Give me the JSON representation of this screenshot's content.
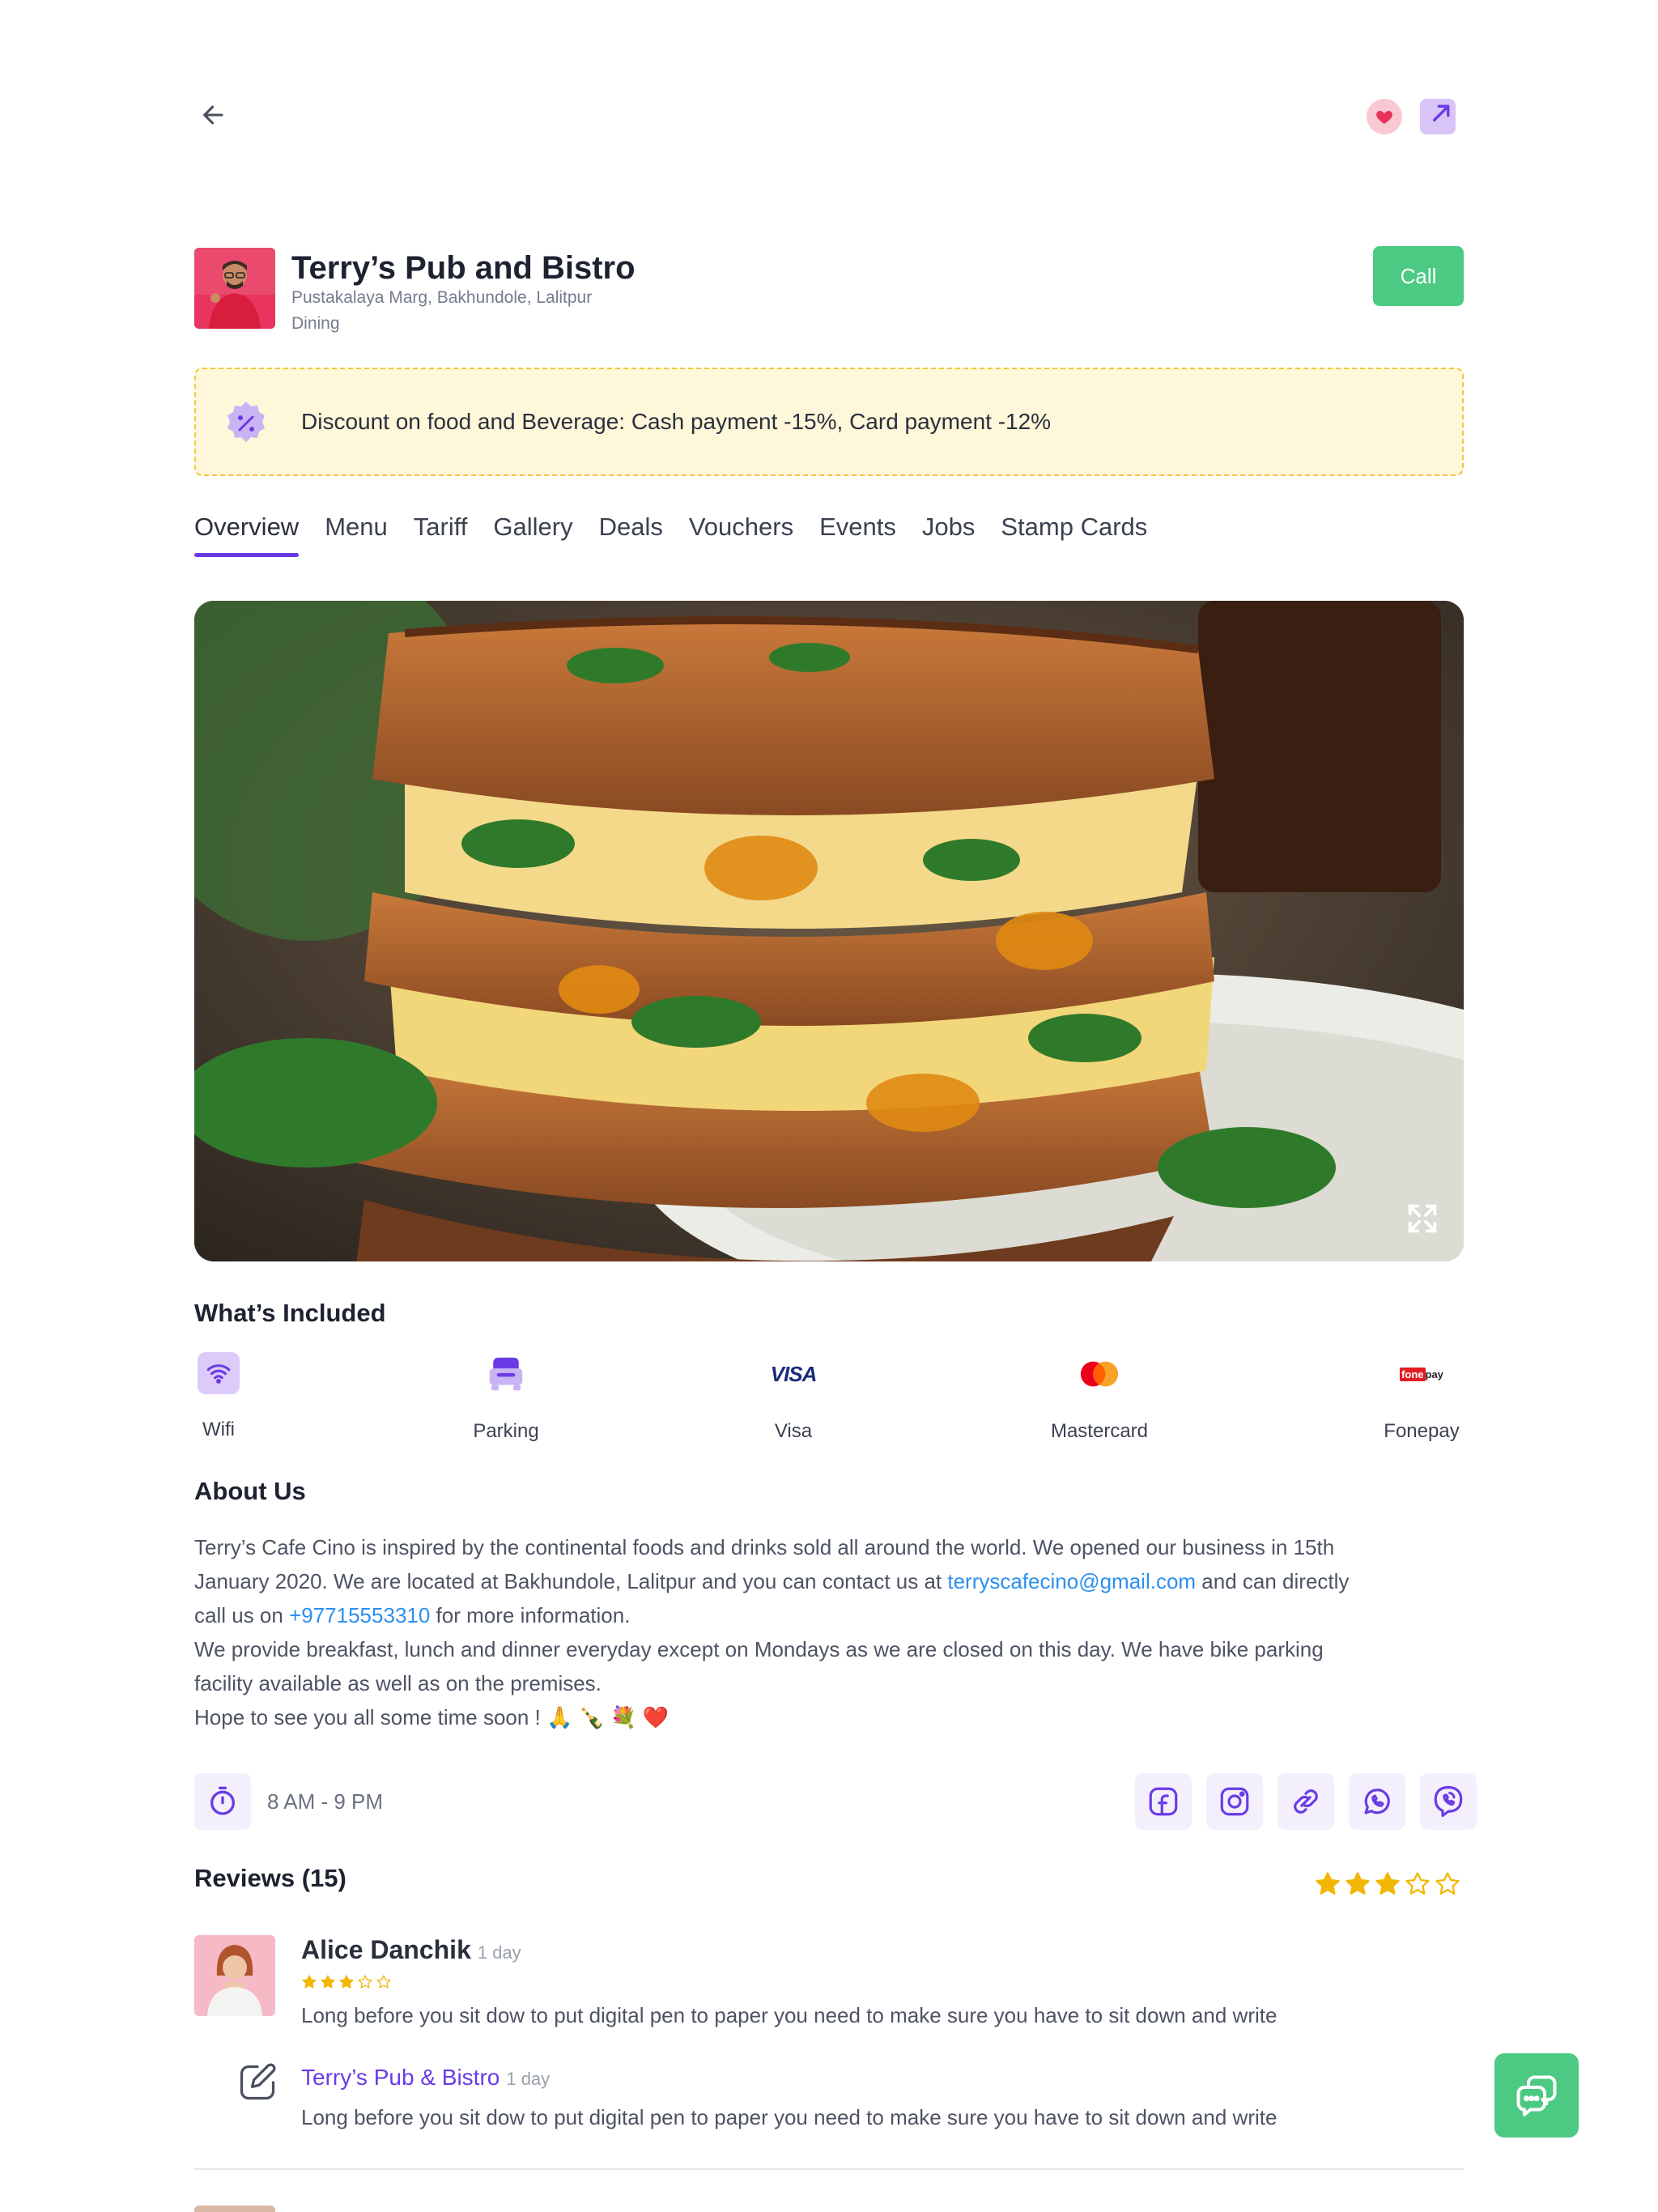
{
  "business": {
    "name": "Terry’s Pub and Bistro",
    "address": "Pustakalaya Marg, Bakhundole, Lalitpur",
    "category": "Dining",
    "call_label": "Call"
  },
  "discount": {
    "text": "Discount on food and Beverage: Cash payment -15%, Card payment -12%"
  },
  "tabs": [
    {
      "label": "Overview",
      "active": true
    },
    {
      "label": "Menu"
    },
    {
      "label": "Tariff"
    },
    {
      "label": "Gallery"
    },
    {
      "label": "Deals"
    },
    {
      "label": "Vouchers"
    },
    {
      "label": "Events"
    },
    {
      "label": "Jobs"
    },
    {
      "label": "Stamp Cards"
    }
  ],
  "included": {
    "title": "What’s Included",
    "items": [
      {
        "label": "Wifi",
        "icon": "wifi-icon"
      },
      {
        "label": "Parking",
        "icon": "car-icon"
      },
      {
        "label": "Visa",
        "icon": "visa-logo",
        "logo_text": "VISA"
      },
      {
        "label": "Mastercard",
        "icon": "mastercard-logo"
      },
      {
        "label": "Fonepay",
        "icon": "fonepay-logo",
        "logo_text_a": "fone",
        "logo_text_b": "pay"
      }
    ]
  },
  "about": {
    "title": "About Us",
    "l1": "Terry’s Cafe Cino is inspired by the continental foods and drinks sold all around the world. We opened our business in 15th",
    "l2a": "January 2020. We are located at Bakhundole, Lalitpur and you can contact us at ",
    "email": "terryscafecino@gmail.com",
    "l2b": " and can directly",
    "l3a": "call us on ",
    "phone": "+97715553310",
    "l3b": " for more information.",
    "l4": "We provide breakfast, lunch and dinner everyday except on Mondays as we are closed on this day. We have bike parking",
    "l5": "facility available as well as on the premises.",
    "l6": "Hope to see you all some time soon ! 🙏 🍾 💐 ❤️"
  },
  "hours": {
    "text": "8 AM - 9 PM"
  },
  "socials": [
    "facebook-icon",
    "instagram-icon",
    "link-icon",
    "whatsapp-icon",
    "viber-icon"
  ],
  "reviews": {
    "title": "Reviews (15)",
    "rating": 3,
    "rating_max": 5,
    "items": [
      {
        "name": "Alice Danchik",
        "time": "1 day",
        "rating": 3,
        "text": "Long before you sit dow to put digital pen to paper you need to make sure you have to sit down and write",
        "reply": {
          "name": "Terry’s Pub & Bistro",
          "time": "1 day",
          "text": "Long before you sit dow to put digital pen to paper you need to make sure you have to sit down and write"
        }
      }
    ]
  },
  "colors": {
    "primary": "#6a3be4",
    "success": "#4cc982",
    "star": "#f2b705",
    "link": "#2b8ff0",
    "discount_bg": "#fff7da"
  }
}
